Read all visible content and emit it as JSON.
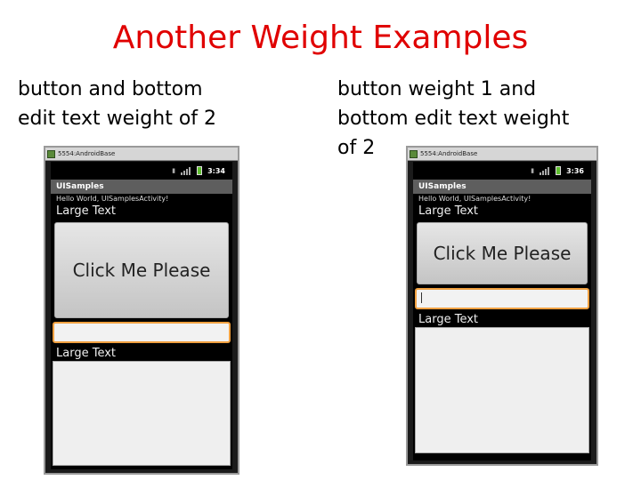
{
  "title": "Another Weight Examples",
  "left": {
    "caption": "button and bottom\nedit text weight of 2",
    "window_title": "5554:AndroidBase",
    "time": "3:34",
    "app_title": "UISamples",
    "hello_text": "Hello World, UISamplesActivity!",
    "large_text_1": "Large Text",
    "button_label": "Click Me Please",
    "large_text_2": "Large Text"
  },
  "right": {
    "caption": "button weight 1 and\nbottom edit text weight\nof 2",
    "window_title": "5554:AndroidBase",
    "time": "3:36",
    "app_title": "UISamples",
    "hello_text": "Hello World, UISamplesActivity!",
    "large_text_1": "Large Text",
    "button_label": "Click Me Please",
    "large_text_2": "Large Text"
  }
}
